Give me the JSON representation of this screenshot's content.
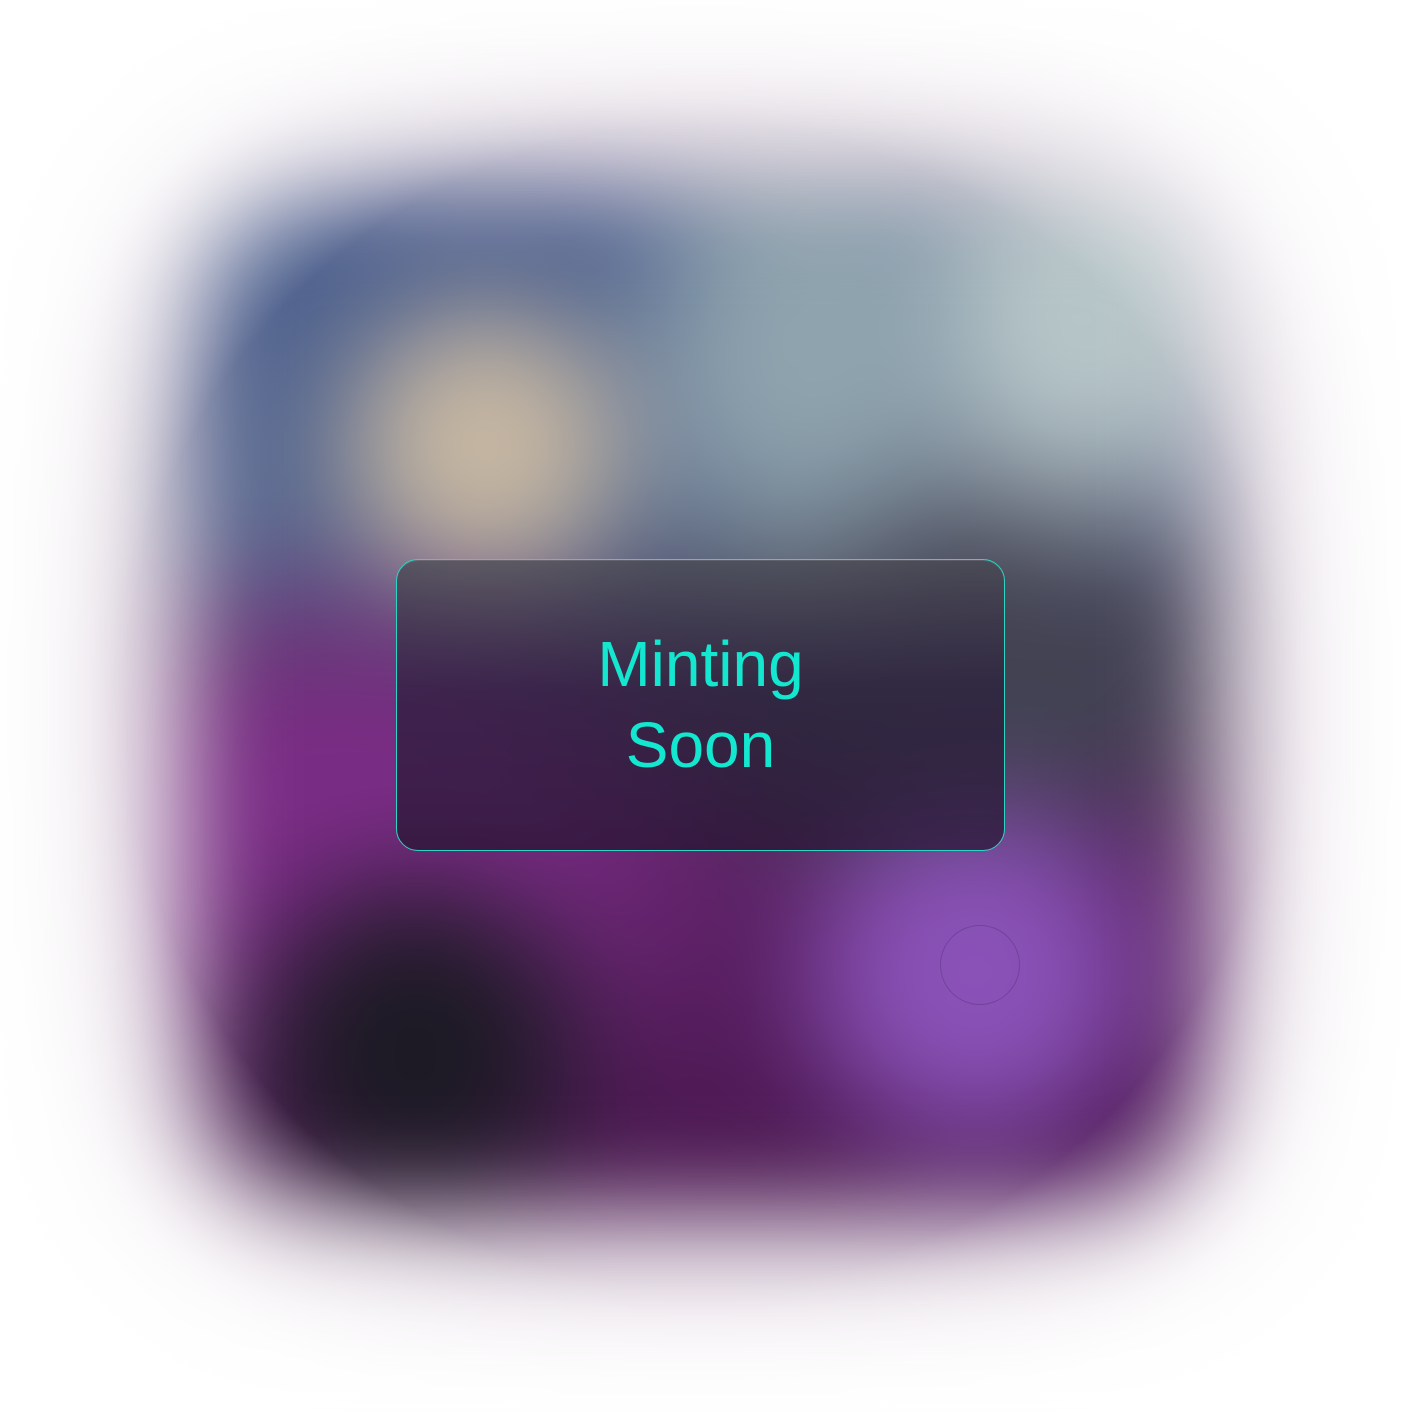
{
  "notice": {
    "line1": "Minting",
    "line2": "Soon"
  },
  "colors": {
    "accent": "#13e7cf",
    "border": "#2ad7c4"
  },
  "icons": {
    "background_mark": "faint-logo-icon"
  }
}
